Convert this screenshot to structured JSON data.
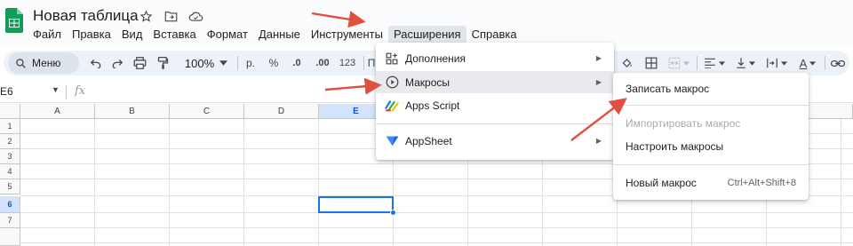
{
  "app": {
    "title": "Новая таблица"
  },
  "menu_bar": [
    {
      "label": "Файл",
      "active": false
    },
    {
      "label": "Правка",
      "active": false
    },
    {
      "label": "Вид",
      "active": false
    },
    {
      "label": "Вставка",
      "active": false
    },
    {
      "label": "Формат",
      "active": false
    },
    {
      "label": "Данные",
      "active": false
    },
    {
      "label": "Инструменты",
      "active": false
    },
    {
      "label": "Расширения",
      "active": true
    },
    {
      "label": "Справка",
      "active": false
    }
  ],
  "toolbar": {
    "search_label": "Меню",
    "zoom": "100%",
    "currency": "р.",
    "percent": "%",
    "decrease_decimals": ".0",
    "increase_decimals": ".00",
    "number_format": "123",
    "font_stub": "П",
    "text_color_letter": "A"
  },
  "formula_bar": {
    "cell_ref": "E6",
    "fx_label": "fx"
  },
  "sheet": {
    "columns": [
      "A",
      "B",
      "C",
      "D",
      "E"
    ],
    "rows": [
      "1",
      "2",
      "3",
      "4",
      "5",
      "6",
      "7"
    ],
    "selected_column": "E",
    "selected_row": "6"
  },
  "extensions_menu": {
    "items": [
      {
        "label": "Дополнения",
        "icon": "addons-icon",
        "submenu": true
      },
      {
        "label": "Макросы",
        "icon": "play-circle-icon",
        "submenu": true
      },
      {
        "label": "Apps Script",
        "icon": "apps-script-icon",
        "submenu": false
      },
      {
        "label": "AppSheet",
        "icon": "appsheet-icon",
        "submenu": true
      }
    ]
  },
  "macros_menu": {
    "items": [
      {
        "label": "Записать макрос",
        "disabled": false
      },
      {
        "label": "Импортировать макрос",
        "disabled": true
      },
      {
        "label": "Настроить макросы",
        "disabled": false
      },
      {
        "label": "Новый макрос",
        "shortcut": "Ctrl+Alt+Shift+8",
        "disabled": false
      }
    ]
  },
  "colors": {
    "accent": "#1a73e8",
    "annotation_arrow": "#e04f3f",
    "sheets_green": "#0f9d58"
  }
}
